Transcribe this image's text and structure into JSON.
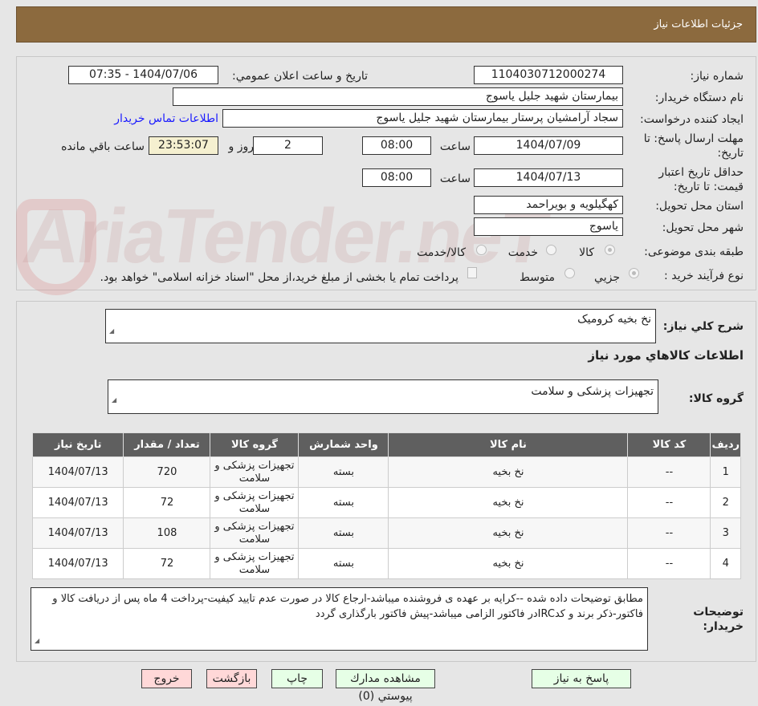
{
  "header": {
    "title": "جزئيات اطلاعات نياز"
  },
  "form": {
    "need_number_label": "شماره نياز:",
    "need_number": "1104030712000274",
    "announce_label": "تاريخ و ساعت اعلان عمومي:",
    "announce_value": "1404/07/06 - 07:35",
    "buyer_org_label": "نام دستگاه خريدار:",
    "buyer_org": "بيمارستان شهيد جليل ياسوج",
    "creator_label": "ايجاد كننده درخواست:",
    "creator": "سجاد آرامشیان پرستار بیمارستان شهید جلیل یاسوج",
    "contact_link": "اطلاعات تماس خريدار",
    "deadline_label": "مهلت ارسال پاسخ: تا تاريخ:",
    "deadline_date": "1404/07/09",
    "time_label": "ساعت",
    "deadline_time": "08:00",
    "days": "2",
    "days_label": "روز و",
    "remaining_time": "23:53:07",
    "remaining_label": "ساعت باقي مانده",
    "validity_label": "حداقل تاريخ اعتبار قيمت: تا تاريخ:",
    "validity_date": "1404/07/13",
    "validity_time": "08:00",
    "province_label": "استان محل تحويل:",
    "province": "کهگیلویه و بویراحمد",
    "city_label": "شهر محل تحويل:",
    "city": "یاسوج",
    "category_label": "طبقه بندی موضوعی:",
    "category_options": [
      "كالا",
      "خدمت",
      "كالا/خدمت"
    ],
    "process_label": "نوع فرآيند خريد :",
    "process_options": [
      "جزيي",
      "متوسط"
    ],
    "payment_note": "پرداخت تمام يا بخشی از مبلغ خريد،از محل \"اسناد خزانه اسلامی\" خواهد بود."
  },
  "watermark": "AriaTender.neT",
  "details": {
    "summary_label": "شرح كلي نياز:",
    "summary": "نخ بخیه کرومیک",
    "goods_info_title": "اطلاعات كالاهاي مورد نياز",
    "goods_group_label": "گروه كالا:",
    "goods_group": "تجهیزات پزشکی و سلامت",
    "table": {
      "headers": [
        "رديف",
        "كد كالا",
        "نام كالا",
        "واحد شمارش",
        "گروه كالا",
        "تعداد / مقدار",
        "تاريخ نياز"
      ],
      "rows": [
        [
          "1",
          "--",
          "نخ بخیه",
          "بسته",
          "تجهیزات پزشکی و سلامت",
          "720",
          "1404/07/13"
        ],
        [
          "2",
          "--",
          "نخ بخیه",
          "بسته",
          "تجهیزات پزشکی و سلامت",
          "72",
          "1404/07/13"
        ],
        [
          "3",
          "--",
          "نخ بخیه",
          "بسته",
          "تجهیزات پزشکی و سلامت",
          "108",
          "1404/07/13"
        ],
        [
          "4",
          "--",
          "نخ بخیه",
          "بسته",
          "تجهیزات پزشکی و سلامت",
          "72",
          "1404/07/13"
        ]
      ]
    },
    "buyer_notes_label": "توضيحات خريدار:",
    "buyer_notes": "مطابق توضیحات داده شده --کرایه بر عهده ی فروشنده میباشد-ارجاع کالا در صورت عدم تایید کیفیت-پرداخت 4 ماه پس از دریافت کالا و فاکتور-ذکر برند و کدIRCدر فاکتور الزامی میباشد-پیش فاکتور بارگذاری گردد"
  },
  "buttons": {
    "reply": "پاسخ به نياز",
    "attachments": "مشاهده مدارك پيوستي (0)",
    "print": "چاپ",
    "back": "بازگشت",
    "exit": "خروج"
  }
}
